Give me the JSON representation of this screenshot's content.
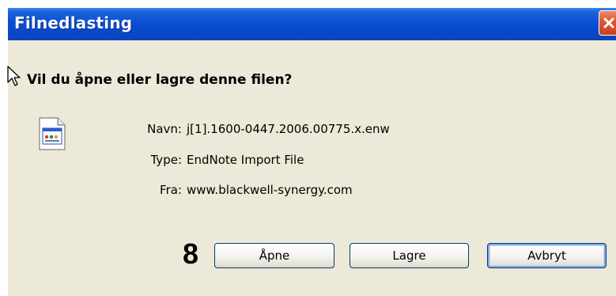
{
  "window": {
    "title": "Filnedlasting",
    "close_icon": "close-icon"
  },
  "dialog": {
    "question": "Vil du åpne eller lagre denne filen?",
    "file_icon": "endnote-file-icon",
    "fields": {
      "name_label": "Navn:",
      "name_value": "j[1].1600-0447.2006.00775.x.enw",
      "type_label": "Type:",
      "type_value": "EndNote Import File",
      "from_label": "Fra:",
      "from_value": "www.blackwell-synergy.com"
    }
  },
  "annotation": {
    "step_number": "8"
  },
  "buttons": {
    "open": "Åpne",
    "save": "Lagre",
    "cancel": "Avbryt"
  },
  "colors": {
    "titlebar": "#0b4fd6",
    "dialog_background": "#ece9d8",
    "close_button": "#e05a34",
    "button_border": "#003c74"
  }
}
